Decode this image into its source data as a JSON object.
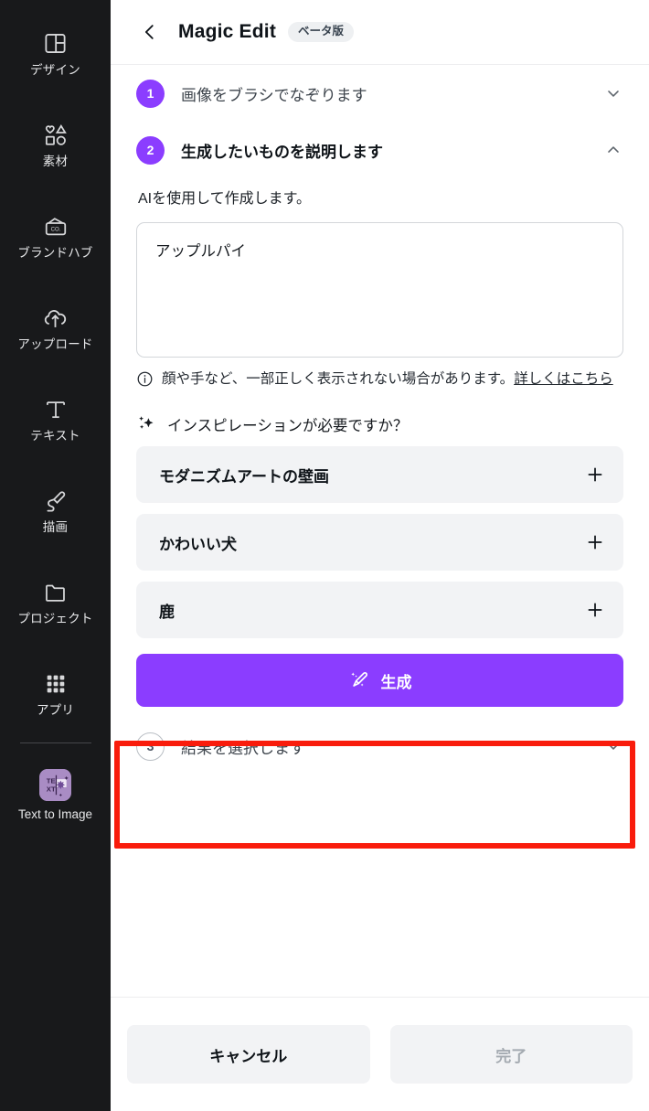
{
  "sidebar": {
    "items": [
      {
        "label": "デザイン",
        "icon": "layout-grid-icon"
      },
      {
        "label": "素材",
        "icon": "shapes-icon"
      },
      {
        "label": "ブランドハブ",
        "icon": "brand-hub-icon"
      },
      {
        "label": "アップロード",
        "icon": "cloud-upload-icon"
      },
      {
        "label": "テキスト",
        "icon": "text-t-icon"
      },
      {
        "label": "描画",
        "icon": "draw-pen-icon"
      },
      {
        "label": "プロジェクト",
        "icon": "folder-icon"
      },
      {
        "label": "アプリ",
        "icon": "apps-grid-icon"
      }
    ],
    "pinned_app": {
      "label": "Text to Image",
      "icon": "text-to-image-icon",
      "tile_color": "#a98cc4"
    },
    "background": "#18191b"
  },
  "header": {
    "back_icon": "chevron-left-icon",
    "title": "Magic Edit",
    "badge": "ベータ版"
  },
  "steps": [
    {
      "number": "1",
      "label": "画像をブラシでなぞります",
      "state": "done",
      "chevron": "chevron-down-icon"
    },
    {
      "number": "2",
      "label": "生成したいものを説明します",
      "state": "active",
      "chevron": "chevron-up-icon"
    },
    {
      "number": "3",
      "label": "結果を選択します",
      "state": "pending",
      "chevron": "chevron-down-icon"
    }
  ],
  "step2": {
    "description": "AIを使用して作成します。",
    "prompt_value": "アップルパイ",
    "prompt_placeholder": "",
    "hint_icon": "info-circle-icon",
    "hint_text": "顔や手など、一部正しく表示されない場合があります。",
    "hint_link": "詳しくはこちら",
    "inspiration_icon": "sparkles-icon",
    "inspiration_title": "インスピレーションが必要ですか？",
    "inspiration_chips": [
      {
        "label": "モダニズムアートの壁画",
        "action_icon": "plus-icon"
      },
      {
        "label": "かわいい犬",
        "action_icon": "plus-icon"
      },
      {
        "label": "鹿",
        "action_icon": "plus-icon"
      }
    ],
    "generate_button": {
      "label": "生成",
      "icon": "magic-wand-icon",
      "color": "#8b3dff"
    }
  },
  "annotation": {
    "type": "highlight-rectangle",
    "color": "#f91c0c",
    "target": "generate-button"
  },
  "footer": {
    "cancel_label": "キャンセル",
    "done_label": "完了",
    "done_disabled": true
  }
}
